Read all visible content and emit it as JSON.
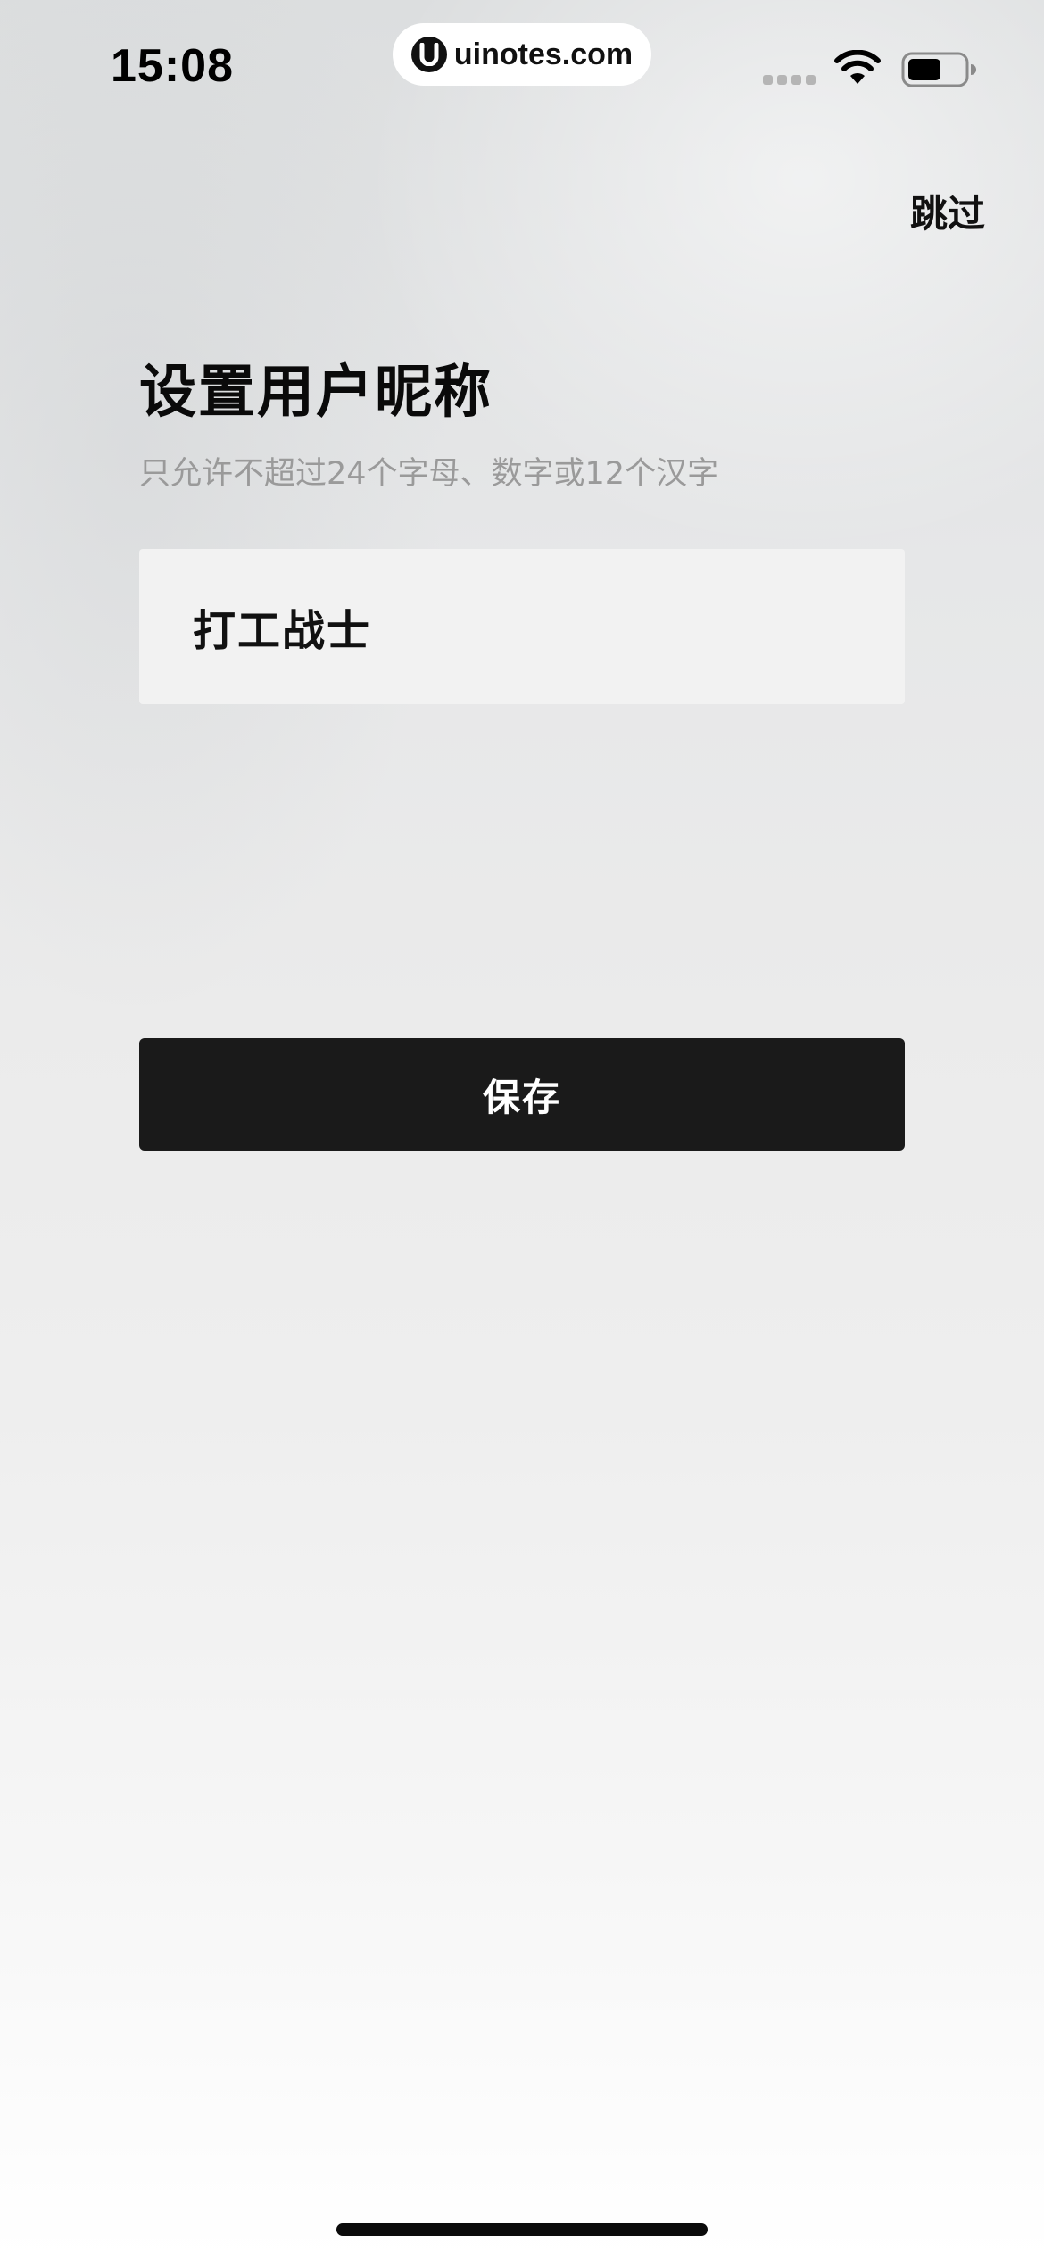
{
  "status_bar": {
    "time": "15:08",
    "url": "uinotes.com",
    "icons": [
      "signal-icon",
      "wifi-icon",
      "battery-icon"
    ]
  },
  "header": {
    "skip_label": "跳过"
  },
  "main": {
    "title": "设置用户昵称",
    "hint": "只允许不超过24个字母、数字或12个汉字",
    "nickname_value": "打工战士",
    "save_label": "保存"
  },
  "colors": {
    "button_bg": "#1a1a1a",
    "input_bg": "#f2f2f2",
    "hint_text": "#9a9a9a"
  }
}
